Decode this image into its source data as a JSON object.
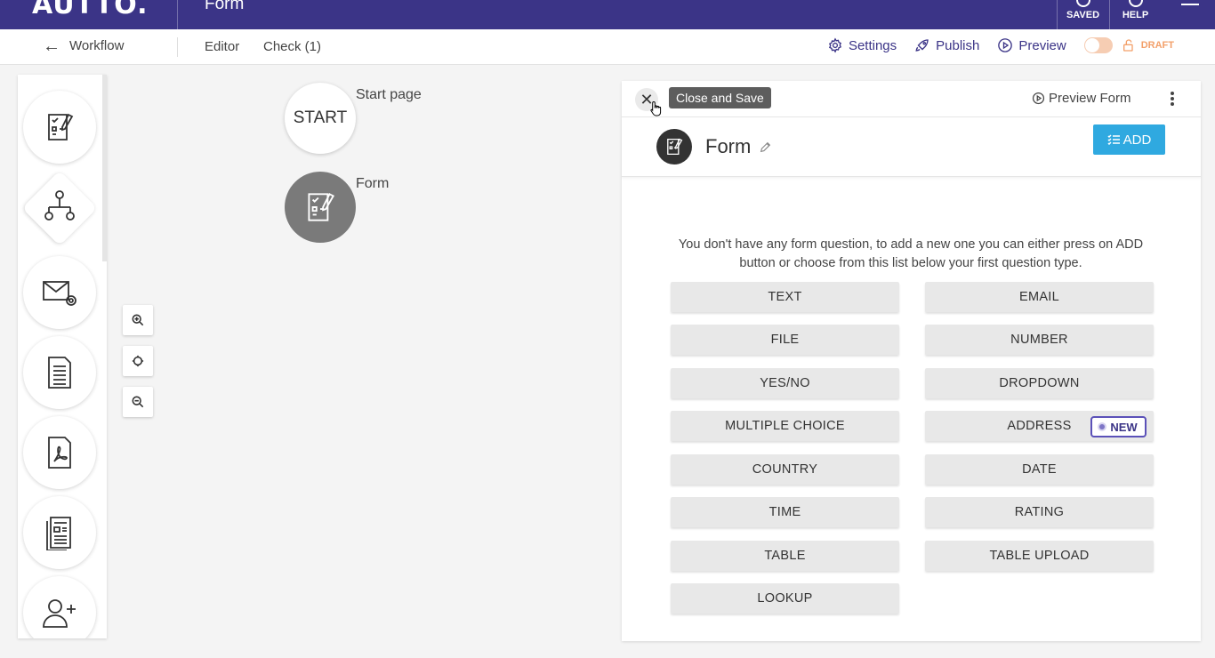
{
  "header": {
    "logo": "AUTTO.",
    "page_name": "Form",
    "saved_label": "SAVED",
    "help_label": "HELP"
  },
  "subbar": {
    "back_label": "Workflow",
    "tab_editor": "Editor",
    "tab_check": "Check (1)",
    "settings": "Settings",
    "publish": "Publish",
    "preview": "Preview",
    "status": "DRAFT"
  },
  "canvas": {
    "start_node": "START",
    "start_label": "Start page",
    "form_label": "Form"
  },
  "panel": {
    "tooltip": "Close and Save",
    "preview_form": "Preview Form",
    "form_title": "Form",
    "add_label": "ADD",
    "empty_message": "You don't have any form question, to add a new one you can either press on ADD button or choose from this list below your first question type.",
    "question_types": [
      "TEXT",
      "EMAIL",
      "FILE",
      "NUMBER",
      "YES/NO",
      "DROPDOWN",
      "MULTIPLE CHOICE",
      "ADDRESS",
      "COUNTRY",
      "DATE",
      "TIME",
      "RATING",
      "TABLE",
      "TABLE UPLOAD",
      "LOOKUP"
    ],
    "new_badge": "NEW"
  },
  "colors": {
    "header_bg": "#3b3487",
    "accent": "#2fa9e0",
    "draft": "#f3a06a"
  }
}
